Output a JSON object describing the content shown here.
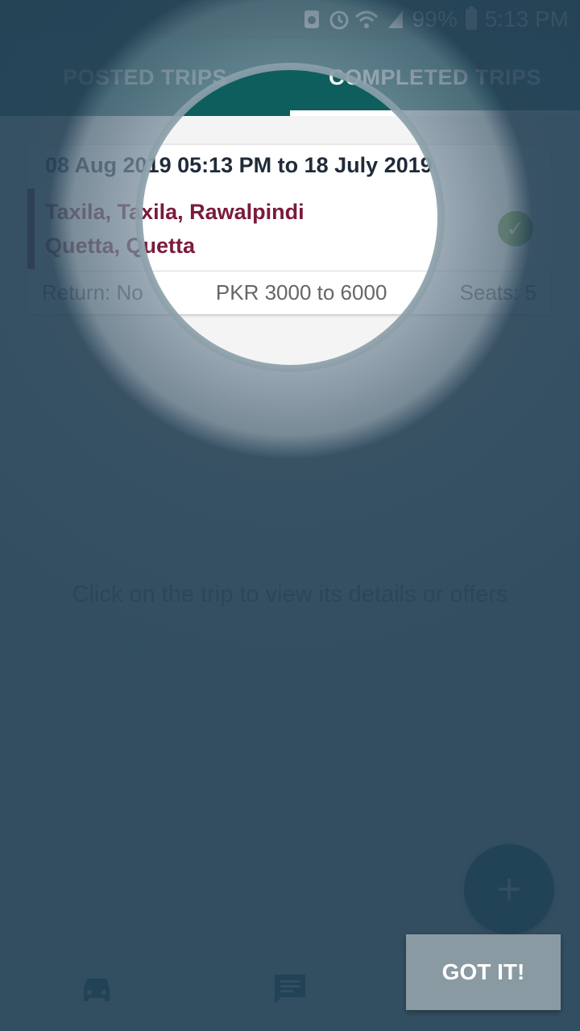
{
  "statusbar": {
    "battery": "99%",
    "time": "5:13 PM",
    "icons": [
      "recycle-icon",
      "alarm-icon",
      "wifi-icon",
      "signal-icon",
      "battery-icon"
    ]
  },
  "tabs": [
    {
      "label": "POSTED TRIPS",
      "active": false
    },
    {
      "label": "COMPLETED TRIPS",
      "active": true
    }
  ],
  "trip": {
    "date_range": "08 Aug 2019 05:13 PM  to  18 July 2019",
    "from": "Taxila, Taxila, Rawalpindi",
    "to": "Quetta, Quetta",
    "return_label": "Return: No",
    "price": "PKR 3000  to  6000",
    "seats": "Seats:   5"
  },
  "hint": "Click on the trip to view its details or offers",
  "fab": {
    "label": "+"
  },
  "showcase": {
    "button_label": "GOT IT!"
  },
  "bottomnav": {
    "items": [
      "car-icon",
      "chat-icon"
    ]
  },
  "colors": {
    "primary": "#0e5e5e",
    "accent": "#7a1b3b",
    "overlay": "#2e4a5c"
  }
}
